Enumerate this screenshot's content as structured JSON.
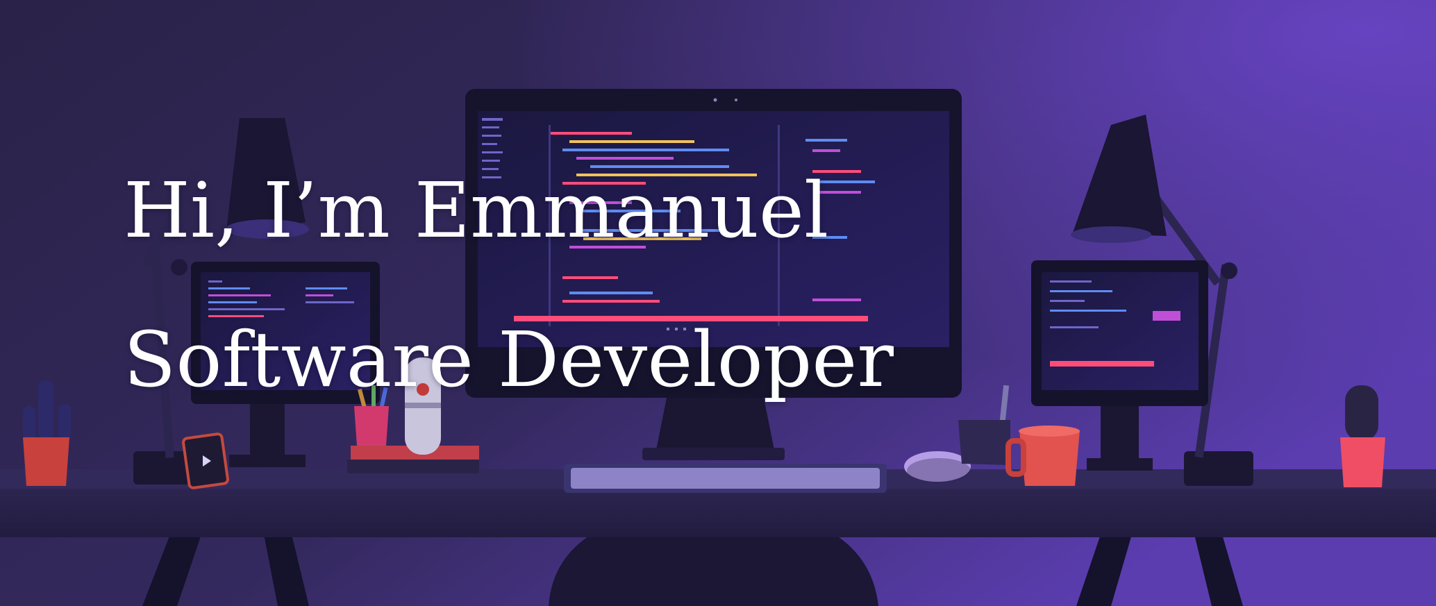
{
  "hero": {
    "greeting": "Hi, I’m Emmanuel",
    "role": "Software Developer"
  },
  "colors": {
    "background_dark": "#1c1838",
    "background_violet": "#5a3aa8",
    "accent_pink": "#ff4d7a",
    "accent_red": "#e2524f",
    "text": "#ffffff"
  }
}
